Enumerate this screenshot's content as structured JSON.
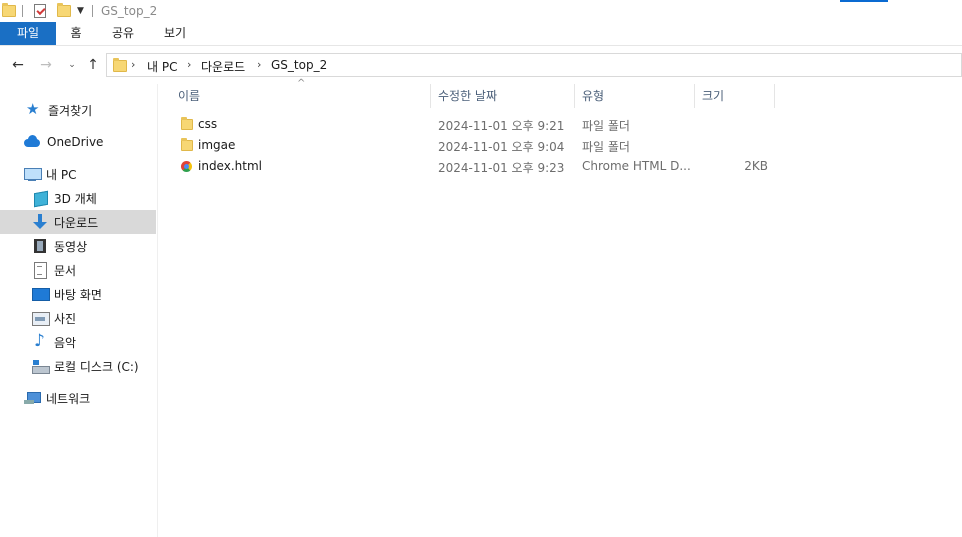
{
  "window": {
    "title": "GS_top_2"
  },
  "ribbon": {
    "tabs": [
      {
        "label": "파일",
        "active": true
      },
      {
        "label": "홈"
      },
      {
        "label": "공유"
      },
      {
        "label": "보기"
      }
    ]
  },
  "address": {
    "crumbs": [
      "내 PC",
      "다운로드",
      "GS_top_2"
    ]
  },
  "sidebar": {
    "items": [
      {
        "label": "즐겨찾기",
        "icon": "star-icon"
      },
      {
        "label": "OneDrive",
        "icon": "cloud-icon"
      },
      {
        "label": "내 PC",
        "icon": "pc-icon"
      },
      {
        "label": "3D 개체",
        "icon": "cube-icon"
      },
      {
        "label": "다운로드",
        "icon": "download-arrow-icon",
        "selected": true
      },
      {
        "label": "동영상",
        "icon": "film-icon"
      },
      {
        "label": "문서",
        "icon": "document-icon"
      },
      {
        "label": "바탕 화면",
        "icon": "desktop-icon"
      },
      {
        "label": "사진",
        "icon": "picture-icon"
      },
      {
        "label": "음악",
        "icon": "music-note-icon"
      },
      {
        "label": "로컬 디스크 (C:)",
        "icon": "drive-icon"
      },
      {
        "label": "네트워크",
        "icon": "network-icon"
      }
    ]
  },
  "columns": {
    "name": "이름",
    "date": "수정한 날짜",
    "type": "유형",
    "size": "크기"
  },
  "files": [
    {
      "name": "css",
      "date": "2024-11-01 오후 9:21",
      "type": "파일 폴더",
      "size": "",
      "icon": "folder-icon"
    },
    {
      "name": "imgae",
      "date": "2024-11-01 오후 9:04",
      "type": "파일 폴더",
      "size": "",
      "icon": "folder-icon"
    },
    {
      "name": "index.html",
      "date": "2024-11-01 오후 9:23",
      "type": "Chrome HTML D...",
      "size": "2KB",
      "icon": "chrome-icon"
    }
  ],
  "colors": {
    "accent": "#1a6fc4",
    "selected": "#d9d9d9",
    "folder": "#f7d774"
  }
}
